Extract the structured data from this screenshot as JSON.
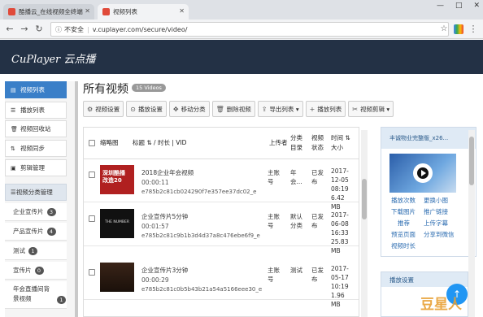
{
  "browser": {
    "tabs": [
      {
        "title": "酷播云_在线视频全终端",
        "active": false
      },
      {
        "title": "视频列表",
        "active": true
      }
    ],
    "window_controls": [
      "—",
      "□",
      "✕"
    ],
    "security_label": "不安全",
    "url": "v.cuplayer.com/secure/video/"
  },
  "app": {
    "logo": "CuPlayer 云点播"
  },
  "sidebar": {
    "items": [
      {
        "label": "视频列表",
        "icon": "film-icon",
        "active": true
      },
      {
        "label": "播放列表",
        "icon": "list-icon",
        "active": false
      },
      {
        "label": "视频回收站",
        "icon": "trash-icon",
        "active": false
      },
      {
        "label": "视频同步",
        "icon": "sync-icon",
        "active": false
      },
      {
        "label": "剪辑管理",
        "icon": "clip-icon",
        "active": false
      }
    ],
    "section": {
      "label": "视频分类管理",
      "icon": "list-icon"
    },
    "categories": [
      {
        "label": "企业宣传片",
        "count": "3"
      },
      {
        "label": "产品宣传片",
        "count": "4"
      },
      {
        "label": "测试",
        "count": "1"
      },
      {
        "label": "宣传片",
        "count": "0"
      },
      {
        "label": "年会直播间背景视频",
        "count": "1"
      }
    ]
  },
  "main": {
    "title": "所有视频",
    "count_badge": "15 Videos",
    "actions": [
      {
        "label": "视频设置",
        "icon": "gear-icon"
      },
      {
        "label": "播放设置",
        "icon": "play-circle-icon"
      },
      {
        "label": "移动分类",
        "icon": "move-icon"
      },
      {
        "label": "删除视频",
        "icon": "trash-icon"
      },
      {
        "label": "导出列表 ▾",
        "icon": "export-icon"
      },
      {
        "label": "播放列表",
        "icon": "plus-icon"
      },
      {
        "label": "视频剪辑 ▾",
        "icon": "scissors-icon"
      }
    ],
    "table": {
      "headers": {
        "thumb": "缩略图",
        "title": "标题 ⇅ / 时长 | VID",
        "uploader": "上传者",
        "category": "分类目录",
        "status": "视频状态",
        "date": "时间 ⇅ 大小"
      },
      "rows": [
        {
          "title": "2018企业年会视频",
          "duration": "00:00:11",
          "vid": "e785b2c81cb024290f7e357ee37dc02_e",
          "uploader": "主账号",
          "category": "年会...",
          "status": "已发布",
          "date": "2017-12-05",
          "time": "08:19",
          "size": "6.42 MB",
          "thumb_text": "深圳酷播\n改造20",
          "thumb_color": "#b02020"
        },
        {
          "title": "企业宣传片5分钟",
          "duration": "00:01:57",
          "vid": "e785b2c81c9b1b3d4d37a8c476ebe6f9_e",
          "uploader": "主账号",
          "category": "默认分类",
          "status": "已发布",
          "date": "2017-06-08",
          "time": "16:33",
          "size": "25.83 MB",
          "thumb_text": "THE NUMBER",
          "thumb_color": "#111111"
        },
        {
          "title": "企业宣传片3分钟",
          "duration": "00:00:29",
          "vid": "e785b2c81c0b5b43b21a54a5166eee30_e",
          "uploader": "主账号",
          "category": "测试",
          "status": "已发布",
          "date": "2017-05-17",
          "time": "10:19",
          "size": "1.96 MB",
          "thumb_text": "",
          "thumb_color": "#2a1a12"
        }
      ]
    }
  },
  "right_panel": {
    "title": "丰诚物业完整版_x26...",
    "links": [
      "播放次数",
      "更换小图",
      "下载图片",
      "推广链接",
      "推荐",
      "上传字幕",
      "预览页面",
      "分享到微信",
      "视频时长"
    ]
  },
  "panel2": {
    "title": "播放设置"
  },
  "watermark": "豆星人"
}
